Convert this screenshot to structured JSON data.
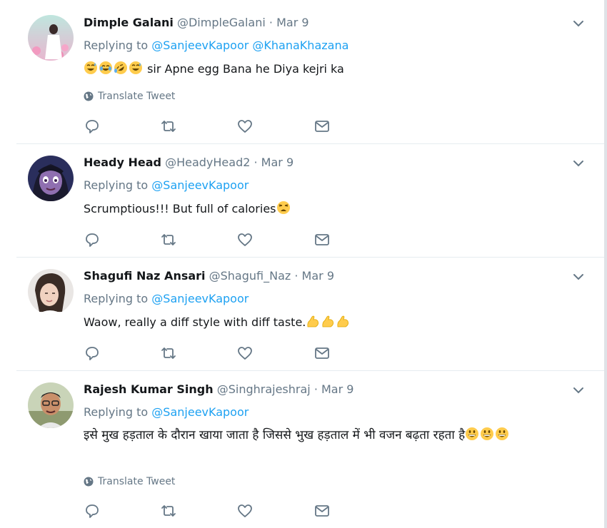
{
  "tweets": [
    {
      "name": "Dimple Galani",
      "handle": "@DimpleGalani",
      "sep": " · ",
      "date": "Mar 9",
      "replying_label": "Replying to ",
      "mentions": [
        "@SanjeevKapoor",
        "@KhanaKhazana"
      ],
      "emojis": [
        "sweat-smile-emoji",
        "joy-emoji",
        "rofl-emoji",
        "sweat-smile-emoji"
      ],
      "text": " sir Apne egg Bana he Diya kejri ka",
      "translate": "Translate Tweet"
    },
    {
      "name": "Heady Head",
      "handle": "@HeadyHead2",
      "sep": " · ",
      "date": "Mar 9",
      "replying_label": "Replying to ",
      "mentions": [
        "@SanjeevKapoor"
      ],
      "text": "Scrumptious!!! But full of calories",
      "trailing_emojis": [
        "weary-emoji"
      ]
    },
    {
      "name": "Shagufi Naz Ansari",
      "handle": "@Shagufi_Naz",
      "sep": " · ",
      "date": "Mar 9",
      "replying_label": "Replying to ",
      "mentions": [
        "@SanjeevKapoor"
      ],
      "text": "Waow, really a diff style with diff taste.",
      "trailing_emojis": [
        "flexed-biceps-emoji",
        "flexed-biceps-emoji",
        "flexed-biceps-emoji"
      ]
    },
    {
      "name": "Rajesh Kumar Singh",
      "handle": "@Singhrajeshraj",
      "sep": " · ",
      "date": "Mar 9",
      "replying_label": "Replying to ",
      "mentions": [
        "@SanjeevKapoor"
      ],
      "text": "इसे मुख हड़ताल के दौरान खाया जाता है जिससे  भुख हड़ताल में भी वजन बढ़ता रहता है",
      "trailing_emojis": [
        "grinning-emoji",
        "grinning-emoji",
        "grinning-emoji"
      ],
      "translate": "Translate Tweet"
    }
  ],
  "colors": {
    "link": "#1da1f2",
    "muted": "#657786",
    "text": "#14171a",
    "divider": "#e6ecf0"
  }
}
